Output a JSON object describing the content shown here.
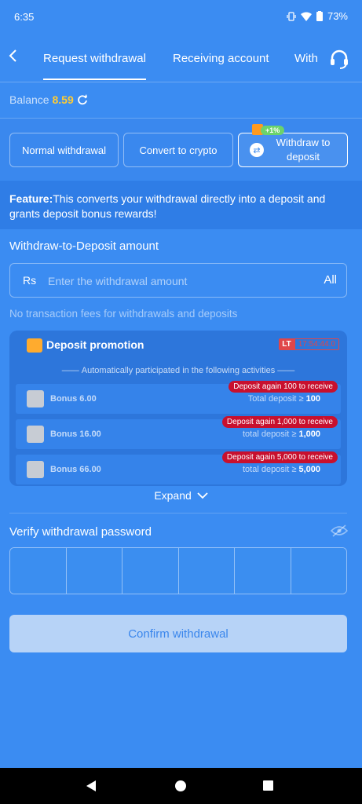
{
  "status_bar": {
    "time": "6:35",
    "battery": "73%",
    "icons": [
      "vibrate-icon",
      "wifi-icon",
      "battery-icon"
    ]
  },
  "header": {
    "back_icon": "chevron-left-icon",
    "tabs": [
      {
        "label": "Request withdrawal",
        "active": true
      },
      {
        "label": "Receiving account",
        "active": false
      },
      {
        "label": "With",
        "active": false
      }
    ],
    "support_icon": "headset-icon"
  },
  "balance": {
    "label": "Balance",
    "value": "8.59",
    "refresh_icon": "refresh-icon"
  },
  "modes": [
    {
      "label": "Normal withdrawal",
      "active": false
    },
    {
      "label": "Convert to crypto",
      "active": false
    },
    {
      "label": "Withdraw to deposit",
      "active": true,
      "badge": "+1%"
    }
  ],
  "feature": {
    "label": "Feature:",
    "text": "This converts your withdrawal directly into a deposit and grants deposit bonus rewards!"
  },
  "amount": {
    "title": "Withdraw-to-Deposit amount",
    "currency": "Rs",
    "placeholder": "Enter the withdrawal amount",
    "all_label": "All",
    "fees_note": "No transaction fees for withdrawals and deposits"
  },
  "promotion": {
    "title": "Deposit promotion",
    "lt_label": "LT",
    "countdown": "17:54:44.0",
    "subtitle": "Automatically participated in the following activities",
    "items": [
      {
        "bonus": "Bonus 6.00",
        "condition_text": "Total deposit ≥",
        "condition_value": "100",
        "tag": "Deposit again 100 to receive"
      },
      {
        "bonus": "Bonus 16.00",
        "condition_text": "total deposit ≥",
        "condition_value": "1,000",
        "tag": "Deposit again 1,000 to receive"
      },
      {
        "bonus": "Bonus 66.00",
        "condition_text": "total deposit ≥",
        "condition_value": "5,000",
        "tag": "Deposit again 5,000 to receive"
      }
    ],
    "expand_label": "Expand"
  },
  "password": {
    "title": "Verify withdrawal password",
    "eye_icon": "eye-off-icon",
    "cells": 6
  },
  "confirm_label": "Confirm withdrawal",
  "colors": {
    "background": "#3b8cf2",
    "accent_balance": "#ffcc33",
    "tag_red": "#c8102e",
    "badge_green": "#6cd36b"
  }
}
